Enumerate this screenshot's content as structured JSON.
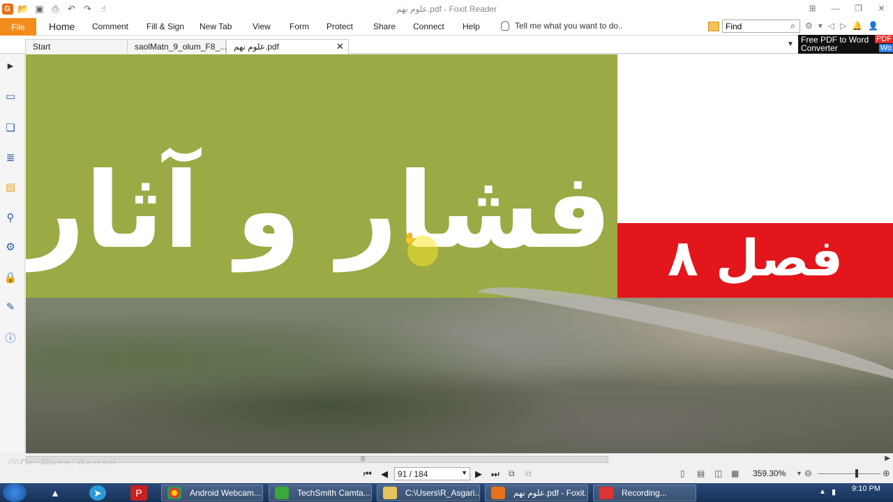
{
  "window": {
    "title": "علوم نهم.pdf - Foxit Reader"
  },
  "ribbon": {
    "file_label": "File",
    "tabs": [
      {
        "label": "Home"
      },
      {
        "label": "Comment"
      },
      {
        "label": "Fill & Sign"
      },
      {
        "label": "New Tab"
      },
      {
        "label": "View"
      },
      {
        "label": "Form"
      },
      {
        "label": "Protect"
      },
      {
        "label": "Share"
      },
      {
        "label": "Connect"
      },
      {
        "label": "Help"
      }
    ],
    "tell_me": "Tell me what you want to do..",
    "find_value": "Find"
  },
  "doc_tabs": [
    {
      "label": "Start"
    },
    {
      "label": "saolMatn_9_olum_F8_..."
    },
    {
      "label": "علوم نهم.pdf"
    }
  ],
  "promo": {
    "line1": "Free PDF to Word",
    "line2": "Converter",
    "badge": "PDF",
    "badge2": "Wo"
  },
  "page": {
    "title_fa": "فشار و آثار آن",
    "chapter_fa": "فصل ۸",
    "accent_green": "#9caa45",
    "accent_red": "#e3161b"
  },
  "status": {
    "page_indicator": "91 / 184",
    "zoom": "359.30%"
  },
  "watermark": "@Dr_Reza_Asgari",
  "taskbar": {
    "apps": [
      {
        "label": "Android Webcam..."
      },
      {
        "label": "TechSmith Camta..."
      },
      {
        "label": "C:\\Users\\R_Asgari..."
      },
      {
        "label": "علوم نهم.pdf - Foxit..."
      },
      {
        "label": "Recording..."
      }
    ],
    "time": "9:10 PM"
  }
}
